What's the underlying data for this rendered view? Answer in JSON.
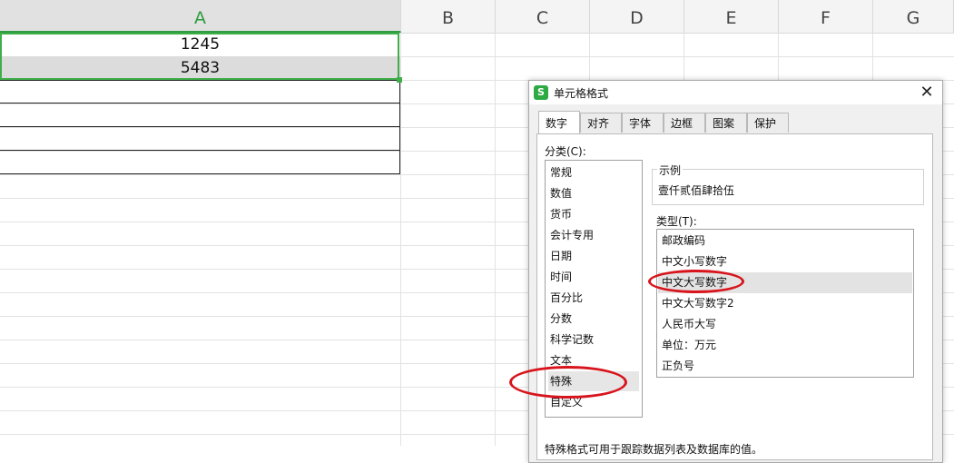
{
  "columns": [
    "A",
    "B",
    "C",
    "D",
    "E",
    "F",
    "G"
  ],
  "cells": [
    "1245",
    "5483"
  ],
  "dialog": {
    "title": "单元格格式",
    "close_glyph": "✕",
    "app_icon_glyph": "S",
    "tabs": [
      "数字",
      "对齐",
      "字体",
      "边框",
      "图案",
      "保护"
    ],
    "category_label": "分类(C):",
    "categories": [
      "常规",
      "数值",
      "货币",
      "会计专用",
      "日期",
      "时间",
      "百分比",
      "分数",
      "科学记数",
      "文本",
      "特殊",
      "自定义"
    ],
    "selected_category": "特殊",
    "sample_label": "示例",
    "sample_value": "壹仟贰佰肆拾伍",
    "type_label": "类型(T):",
    "types": [
      "邮政编码",
      "中文小写数字",
      "中文大写数字",
      "中文大写数字2",
      "人民币大写",
      "单位：万元",
      "正负号"
    ],
    "selected_type": "中文大写数字",
    "description": "特殊格式可用于跟踪数据列表及数据库的值。"
  },
  "accent_color": "#3fae4a",
  "annotation_color": "#d8141c"
}
